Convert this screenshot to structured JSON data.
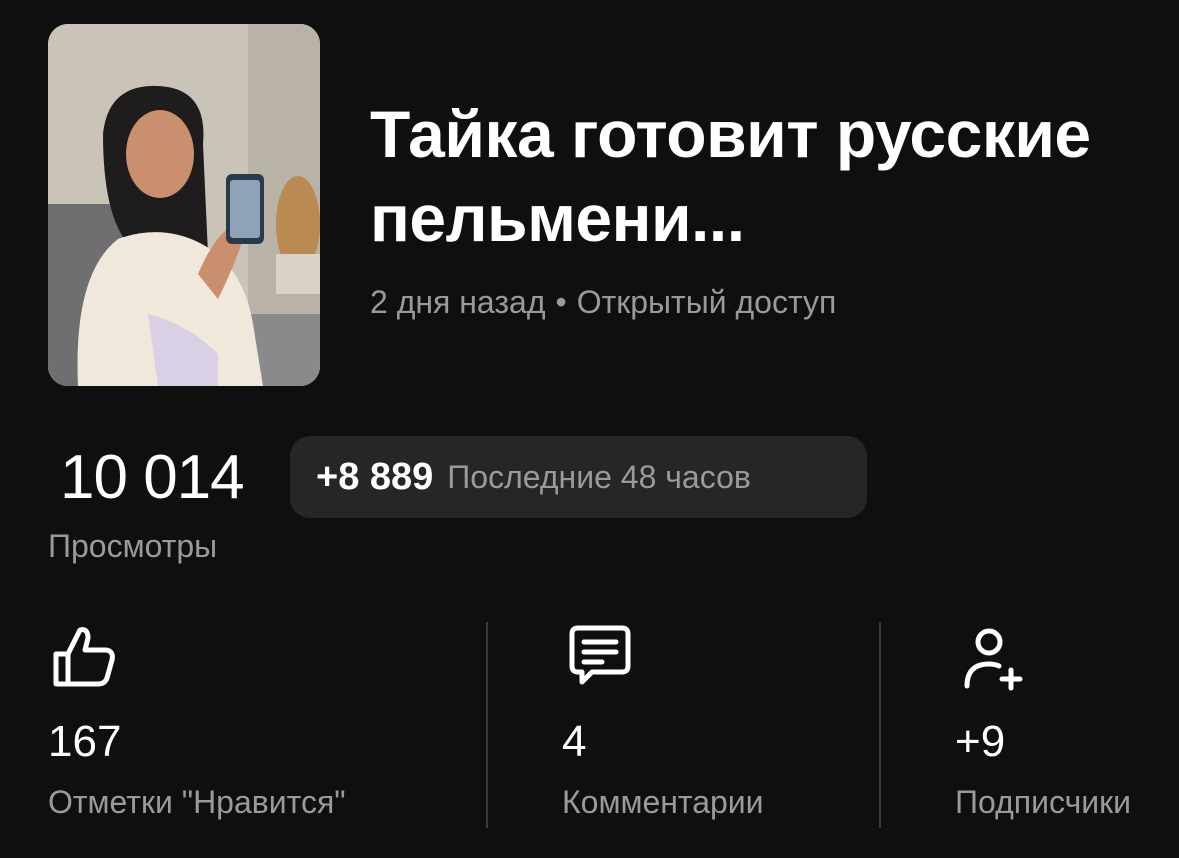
{
  "video": {
    "title": "Тайка готовит русские пельмени...",
    "published": "2 дня назад",
    "separator": "•",
    "access": "Открытый доступ",
    "thumbnail_icon": "video-thumbnail"
  },
  "views": {
    "count": "10 014",
    "delta": "+8 889",
    "period": "Последние 48 часов",
    "label": "Просмотры"
  },
  "stats": {
    "likes": {
      "icon": "thumbs-up-icon",
      "value": "167",
      "label": "Отметки \"Нравится\""
    },
    "comments": {
      "icon": "comment-icon",
      "value": "4",
      "label": "Комментарии"
    },
    "subscribers": {
      "icon": "add-user-icon",
      "value": "+9",
      "label": "Подписчики"
    }
  },
  "colors": {
    "background": "#0f0f0f",
    "text_primary": "#ffffff",
    "text_secondary": "#9a9a9a",
    "pill_background": "#262626",
    "divider": "#3a3a3a"
  }
}
